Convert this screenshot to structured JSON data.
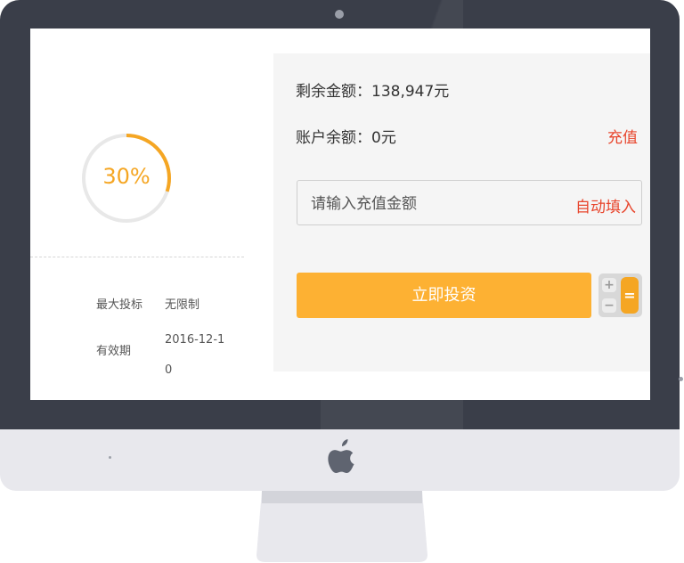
{
  "progress": {
    "percent_label": "30%",
    "fraction": 0.3,
    "color": "#f5a623",
    "track_color": "#e8e8e8"
  },
  "details": {
    "max_bid_label": "最大投标",
    "max_bid_value": "无限制",
    "validity_label": "有效期",
    "validity_value": "2016-12-10"
  },
  "account": {
    "remaining": "剩余金额：138,947元",
    "balance": "账户余额：0元",
    "recharge": "充值"
  },
  "recharge_input": {
    "placeholder": "请输入充值金额",
    "value": "",
    "autofill": "自动填入"
  },
  "invest_button": "立即投资",
  "calculator": {
    "plus": "+",
    "minus": "−",
    "equals": "="
  },
  "colors": {
    "accent_orange": "#fdb133",
    "link_red": "#e8452c",
    "bezel": "#3a3e49",
    "chin": "#e8e8ed"
  },
  "icons": [
    "apple-logo-icon",
    "calculator-icon",
    "camera-icon"
  ]
}
